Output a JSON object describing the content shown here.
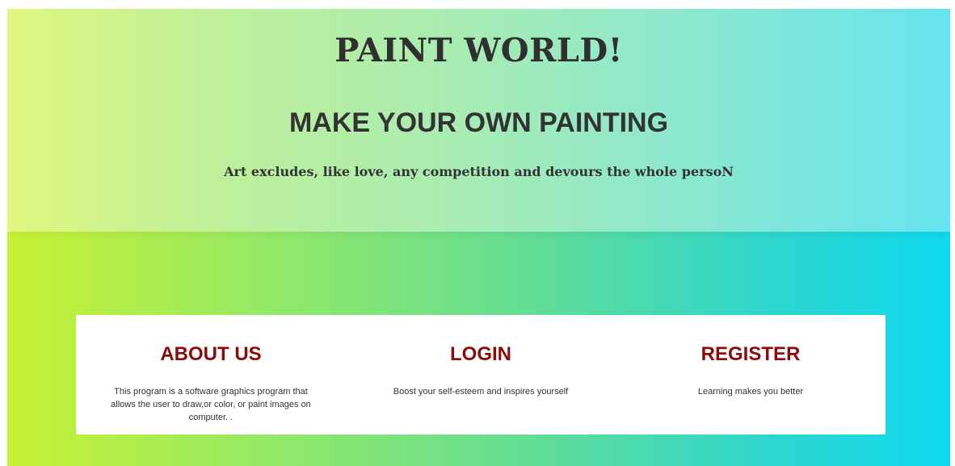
{
  "hero": {
    "title": "PAINT WORLD!",
    "subtitle": "MAKE YOUR OWN PAINTING",
    "quote": "Art excludes, like love, any competition and devours the whole persoN"
  },
  "cards": [
    {
      "title": "ABOUT US",
      "text": "This program is a software graphics     program that\nallows the user to draw,or     color, or paint images on\ncomputer. ."
    },
    {
      "title": "LOGIN",
      "text": "Boost your self-esteem and inspires yourself"
    },
    {
      "title": "REGISTER",
      "text": "Learning makes you better"
    }
  ],
  "colors": {
    "card_title": "#8b0a0a",
    "heading_text": "#303030",
    "gradient_left": "#c8f233",
    "gradient_right": "#0ed8ee"
  }
}
